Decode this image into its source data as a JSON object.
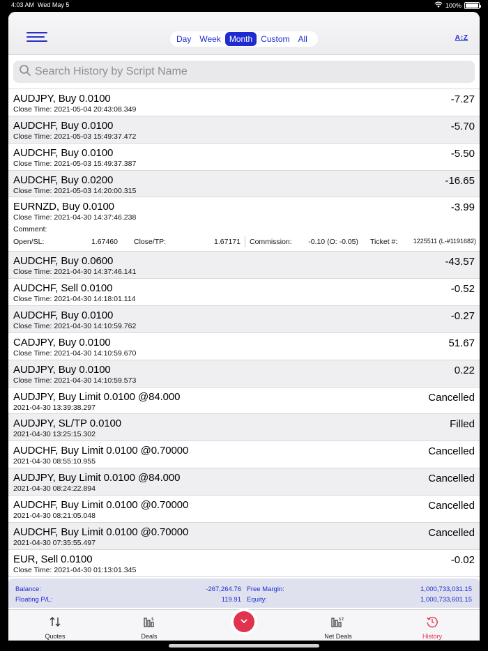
{
  "status_bar": {
    "time": "4:03 AM",
    "date": "Wed May 5",
    "battery": "100%"
  },
  "header": {
    "segments": [
      "Day",
      "Week",
      "Month",
      "Custom",
      "All"
    ],
    "active_segment": "Month",
    "sort_label": "A↕Z"
  },
  "search": {
    "placeholder": "Search History by Script Name"
  },
  "history": [
    {
      "title": "AUDJPY, Buy 0.0100",
      "sub": "Close Time: 2021-05-04 20:43:08.349",
      "value": "-7.27"
    },
    {
      "title": "AUDCHF, Buy 0.0100",
      "sub": "Close Time: 2021-05-03 15:49:37.472",
      "value": "-5.70"
    },
    {
      "title": "AUDCHF, Buy 0.0100",
      "sub": "Close Time: 2021-05-03 15:49:37.387",
      "value": "-5.50"
    },
    {
      "title": "AUDCHF, Buy 0.0200",
      "sub": "Close Time: 2021-05-03 14:20:00.315",
      "value": "-16.65"
    },
    {
      "title": "EURNZD, Buy 0.0100",
      "sub": "Close Time: 2021-04-30 14:37:46.238",
      "value": "-3.99",
      "comment_label": "Comment:",
      "open_sl_label": "Open/SL:",
      "open_sl": "1.67460",
      "close_tp_label": "Close/TP:",
      "close_tp": "1.67171",
      "commission_label": "Commission:",
      "commission": "-0.10 (O: -0.05)",
      "ticket_label": "Ticket #:",
      "ticket": "1225511 (L-#1191682)"
    },
    {
      "title": "AUDCHF, Buy 0.0600",
      "sub": "Close Time: 2021-04-30 14:37:46.141",
      "value": "-43.57"
    },
    {
      "title": "AUDCHF, Sell 0.0100",
      "sub": "Close Time: 2021-04-30 14:18:01.114",
      "value": "-0.52"
    },
    {
      "title": "AUDCHF, Buy 0.0100",
      "sub": "Close Time: 2021-04-30 14:10:59.762",
      "value": "-0.27"
    },
    {
      "title": "CADJPY, Buy 0.0100",
      "sub": "Close Time: 2021-04-30 14:10:59.670",
      "value": "51.67"
    },
    {
      "title": "AUDJPY, Buy 0.0100",
      "sub": "Close Time: 2021-04-30 14:10:59.573",
      "value": "0.22"
    },
    {
      "title": "AUDJPY, Buy Limit 0.0100 @84.000",
      "sub": "2021-04-30 13:39:38.297",
      "value": "Cancelled"
    },
    {
      "title": "AUDJPY, SL/TP 0.0100",
      "sub": "2021-04-30 13:25:15.302",
      "value": "Filled"
    },
    {
      "title": "AUDCHF, Buy Limit 0.0100 @0.70000",
      "sub": "2021-04-30 08:55:10.955",
      "value": "Cancelled"
    },
    {
      "title": "AUDJPY, Buy Limit 0.0100 @84.000",
      "sub": "2021-04-30 08:24:22.894",
      "value": "Cancelled"
    },
    {
      "title": "AUDCHF, Buy Limit 0.0100 @0.70000",
      "sub": "2021-04-30 08:21:05.048",
      "value": "Cancelled"
    },
    {
      "title": "AUDCHF, Buy Limit 0.0100 @0.70000",
      "sub": "2021-04-30 07:35:55.497",
      "value": "Cancelled"
    },
    {
      "title": "EUR, Sell 0.0100",
      "sub": "Close Time: 2021-04-30 01:13:01.345",
      "value": "-0.02"
    }
  ],
  "summary": {
    "balance_label": "Balance:",
    "balance": "-267,264.76",
    "free_margin_label": "Free Margin:",
    "free_margin": "1,000,733,031.15",
    "floating_label": "Floating P/L:",
    "floating": "119.91",
    "equity_label": "Equity:",
    "equity": "1,000,733,601.15"
  },
  "tabs": {
    "quotes": "Quotes",
    "deals": "Deals",
    "net_deals": "Net Deals",
    "history": "History",
    "active": "History"
  },
  "colors": {
    "accent": "#1f2bd1",
    "active_tab": "#e0334d"
  }
}
